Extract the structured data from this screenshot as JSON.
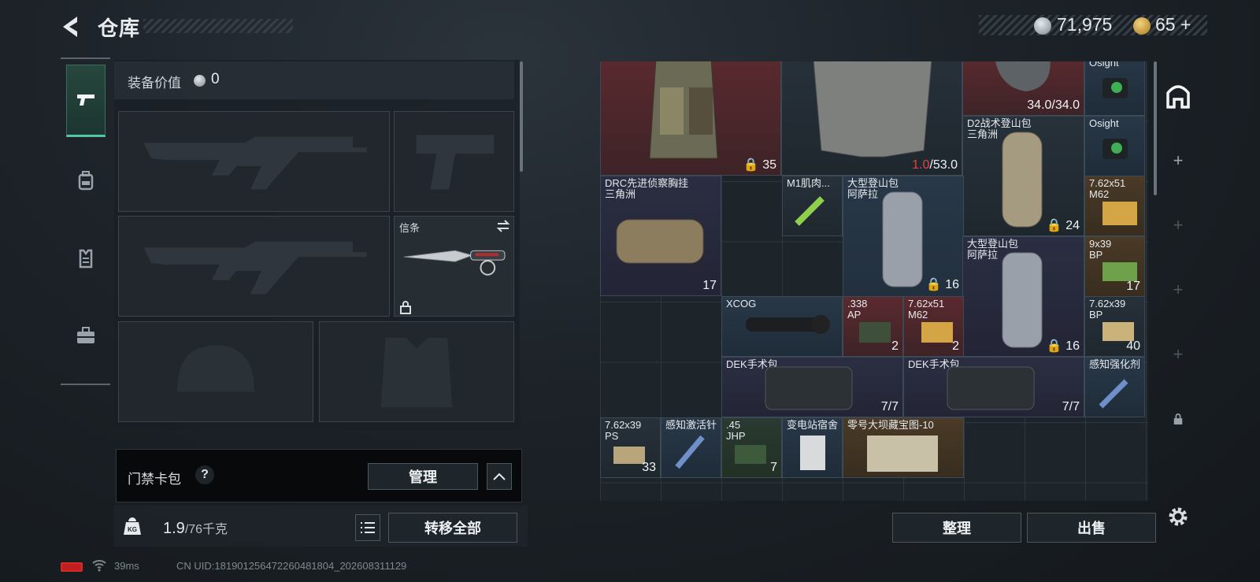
{
  "header": {
    "title": "仓库",
    "silver": "71,975",
    "gold": "65",
    "gold_plus": "+"
  },
  "equipment": {
    "label": "装备价值",
    "value": "0",
    "melee_label": "信条"
  },
  "card_bag": {
    "label": "门禁卡包",
    "help": "?",
    "manage_label": "管理"
  },
  "footer_left": {
    "weight": "1.9",
    "weight_max": "/76千克",
    "transfer_label": "转移全部"
  },
  "status": {
    "ping": "39ms",
    "uid": "CN UID:18190125647226048180​4_202608311129"
  },
  "stash": {
    "items": {
      "vest_count": "35",
      "armor_dur": "1.0",
      "armor_max": "/53.0",
      "helmet_dur": "34.0/34.0",
      "osight1": "Osight",
      "osight2": "Osight",
      "d2_name": "D2战术登山包",
      "d2_sub": "三角洲",
      "d2_count": "24",
      "drc_name": "DRC先进侦察胸挂",
      "drc_sub": "三角洲",
      "drc_count": "17",
      "m1_name": "M1肌肉...",
      "bigpack1_name": "大型登山包",
      "bigpack1_sub": "阿萨拉",
      "bigpack1_count": "16",
      "ammo76251a_name": "7.62x51",
      "ammo76251a_sub": "M62",
      "bigpack2_name": "大型登山包",
      "bigpack2_sub": "阿萨拉",
      "bigpack2_count": "16",
      "ammo939_name": "9x39",
      "ammo939_sub": "BP",
      "ammo939_count": "17",
      "xcog_name": "XCOG",
      "ap338_name": ".338",
      "ap338_sub": "AP",
      "ap338_count": "2",
      "ammo76251b_name": "7.62x51",
      "ammo76251b_sub": "M62",
      "ammo76251b_count": "2",
      "ammo76239bp_name": "7.62x39",
      "ammo76239bp_sub": "BP",
      "ammo76239bp_count": "40",
      "dek1_name": "DEK手术包",
      "dek1_count": "7/7",
      "dek2_name": "DEK手术包",
      "dek2_count": "7/7",
      "sense_name": "感知强化剂",
      "ps_name": "7.62x39",
      "ps_sub": "PS",
      "ps_count": "33",
      "activate_name": "感知激活针",
      "jhp_name": ".45",
      "jhp_sub": "JHP",
      "jhp_count": "7",
      "dorm_name": "变电站宿舍",
      "map_name": "零号大坝藏宝图-10"
    }
  },
  "footer_right": {
    "tidy_label": "整理",
    "sell_label": "出售"
  }
}
